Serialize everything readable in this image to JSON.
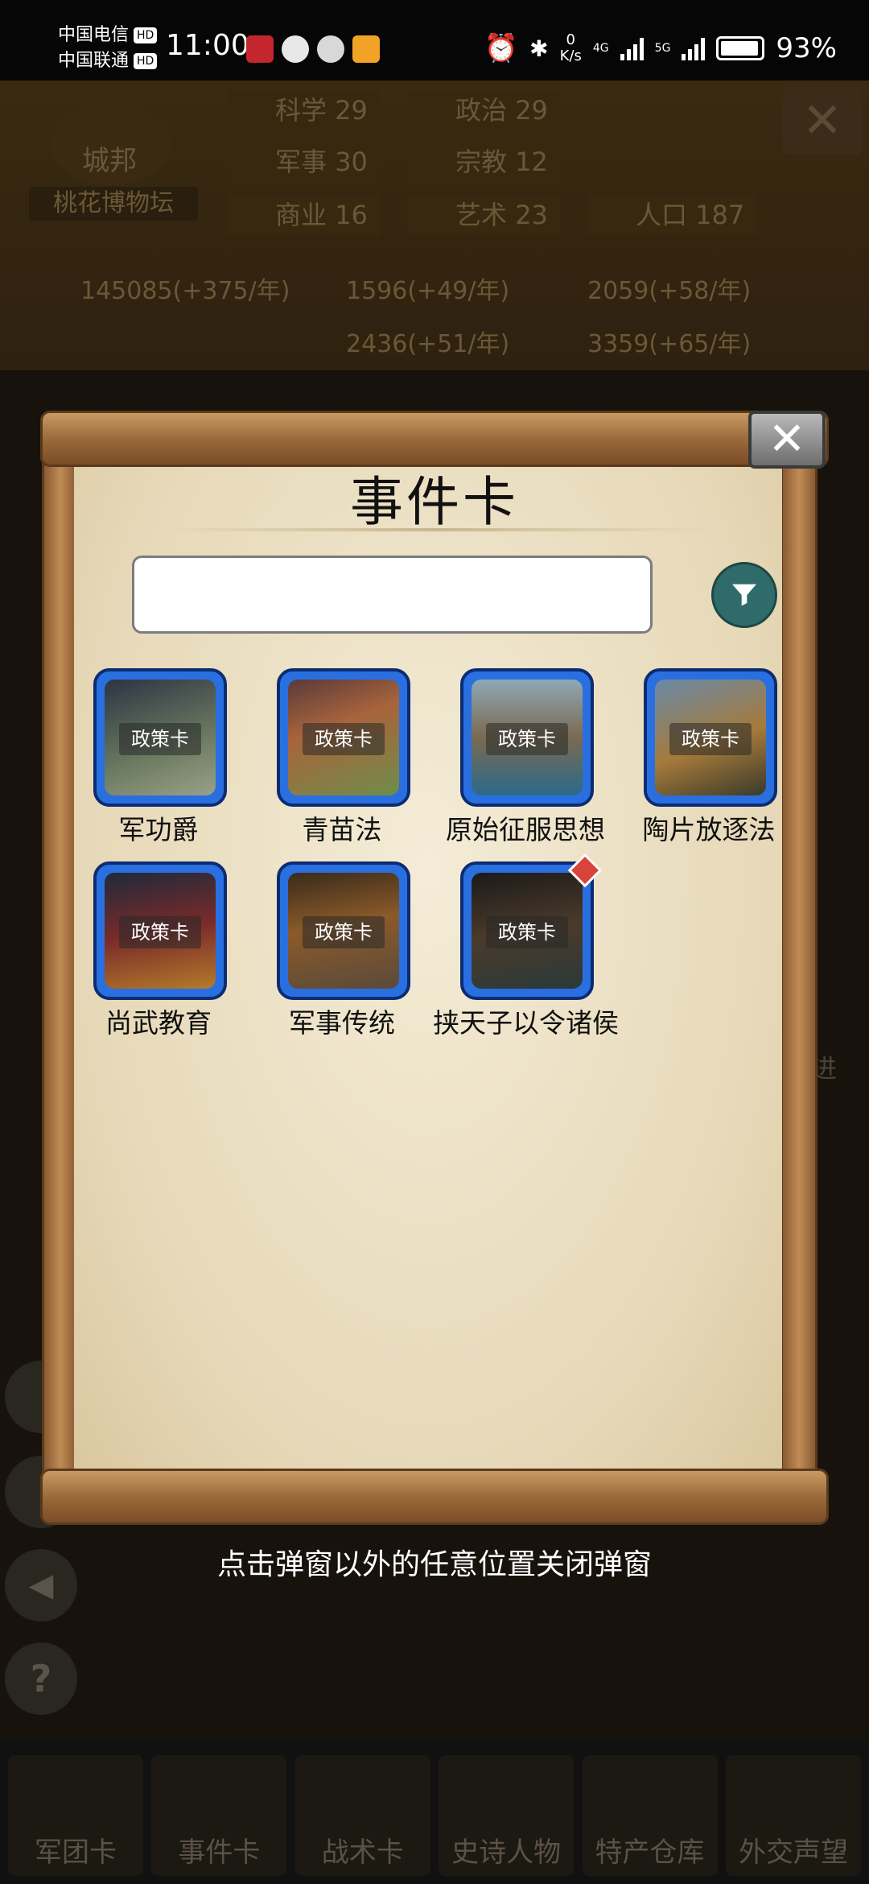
{
  "status_bar": {
    "carrier1": "中国电信",
    "carrier2": "中国联通",
    "hd": "HD",
    "time": "11:00",
    "net_speed_value": "0",
    "net_speed_unit": "K/s",
    "net1": "4G",
    "net2": "5G",
    "battery": "93%"
  },
  "game_header": {
    "city_title": "城邦",
    "city_name": "桃花博物坛",
    "close_icon": "close-icon",
    "stats": [
      {
        "label": "科学",
        "value": "29"
      },
      {
        "label": "政治",
        "value": "29"
      },
      {
        "label": "军事",
        "value": "30"
      },
      {
        "label": "宗教",
        "value": "12"
      },
      {
        "label": "商业",
        "value": "16"
      },
      {
        "label": "艺术",
        "value": "23"
      },
      {
        "label": "人口",
        "value": "187"
      }
    ],
    "resources": [
      "145085(+375/年)",
      "1596(+49/年)",
      "2059(+58/年)",
      "2436(+51/年)",
      "3359(+65/年)"
    ],
    "side_glimpses": [
      "进"
    ]
  },
  "modal": {
    "title": "事件卡",
    "search": {
      "value": "",
      "placeholder": ""
    },
    "filter_icon": "filter-icon",
    "close_icon": "close-icon",
    "cards": [
      {
        "tag": "政策卡",
        "name": "军功爵"
      },
      {
        "tag": "政策卡",
        "name": "青苗法"
      },
      {
        "tag": "政策卡",
        "name": "原始征服思想"
      },
      {
        "tag": "政策卡",
        "name": "陶片放逐法"
      },
      {
        "tag": "政策卡",
        "name": "尚武教育"
      },
      {
        "tag": "政策卡",
        "name": "军事传统"
      },
      {
        "tag": "政策卡",
        "name": "挟天子以令诸侯",
        "badge": true
      }
    ],
    "hint": "点击弹窗以外的任意位置关闭弹窗"
  },
  "bottom_nav": [
    {
      "label": "军团卡"
    },
    {
      "label": "事件卡"
    },
    {
      "label": "战术卡"
    },
    {
      "label": "史诗人物"
    },
    {
      "label": "特产仓库"
    },
    {
      "label": "外交声望"
    }
  ],
  "colors": {
    "card_frame": "#2a6fe0",
    "filter_button": "#2f6b6b",
    "parchment": "#efe4c8",
    "badge": "#d9443a"
  }
}
